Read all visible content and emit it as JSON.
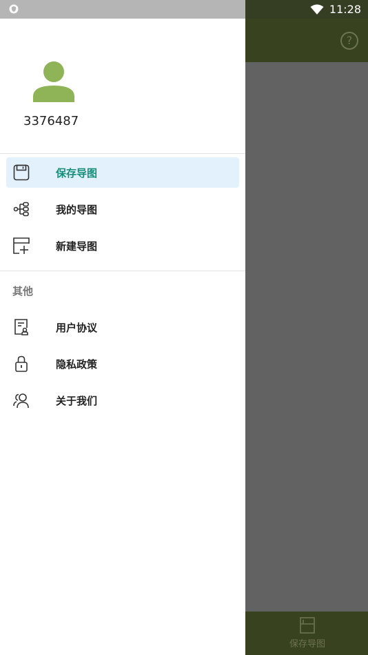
{
  "status_bar": {
    "time": "11:28"
  },
  "background_app": {
    "help_icon": "question-circle-icon",
    "bottom_tab_label": "保存导图"
  },
  "drawer": {
    "user": {
      "id": "3376487"
    },
    "menu": [
      {
        "label": "保存导图",
        "icon": "save-icon",
        "active": true
      },
      {
        "label": "我的导图",
        "icon": "mindmap-icon",
        "active": false
      },
      {
        "label": "新建导图",
        "icon": "new-map-icon",
        "active": false
      }
    ],
    "other_section": {
      "title": "其他",
      "items": [
        {
          "label": "用户协议",
          "icon": "agreement-icon"
        },
        {
          "label": "隐私政策",
          "icon": "lock-icon"
        },
        {
          "label": "关于我们",
          "icon": "users-icon"
        }
      ]
    }
  },
  "colors": {
    "accent": "#168f79",
    "active_bg": "#e3f1fc",
    "avatar": "#8fb457",
    "toolbar_dimmed": "#38421f",
    "scrim": "#626262"
  }
}
